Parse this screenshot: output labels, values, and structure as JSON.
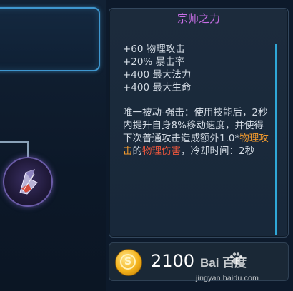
{
  "tooltip": {
    "title": "宗师之力",
    "stats": [
      "+60 物理攻击",
      "+20% 暴击率",
      "+400 最大法力",
      "+400 最大生命"
    ],
    "passive": {
      "text1": "唯一被动-强击：使用技能后，2秒内提升自身8%移动速度，并使得下次普通攻击造成额外1.0*",
      "highlight1": "物理攻击",
      "text2": "的",
      "highlight2": "物理伤害",
      "text3": "，冷却时间：2秒"
    }
  },
  "price": {
    "coin_symbol": "S",
    "amount": "2100"
  },
  "watermark": {
    "logo": "Bai  百度",
    "url": "jingyan.baidu.com"
  },
  "item": {
    "icon": "sword-shard-icon"
  },
  "colors": {
    "title": "#c86ee6",
    "highlight_attack": "#f0992e",
    "highlight_damage": "#e7553c",
    "accent_border": "#3f97cf",
    "scroll_line": "#2fa7d7"
  }
}
